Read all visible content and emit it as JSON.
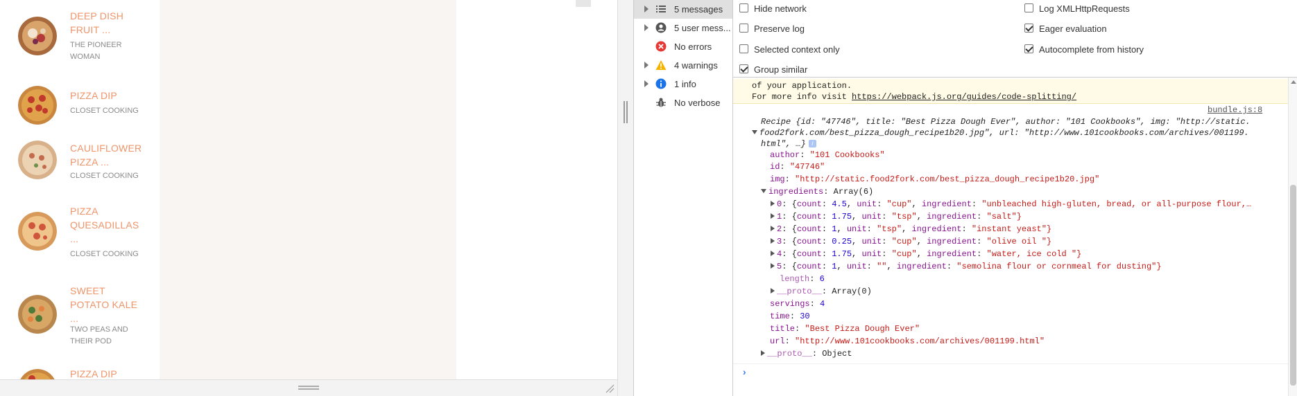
{
  "recipes": [
    {
      "title": "DEEP DISH FRUIT ...",
      "author": "THE PIONEER WOMAN"
    },
    {
      "title": "PIZZA DIP",
      "author": "CLOSET COOKING"
    },
    {
      "title": "CAULIFLOWER PIZZA ...",
      "author": "CLOSET COOKING"
    },
    {
      "title": "PIZZA QUESADILLAS ...",
      "author": "CLOSET COOKING"
    },
    {
      "title": "SWEET POTATO KALE ...",
      "author": "TWO PEAS AND THEIR POD"
    },
    {
      "title": "PIZZA DIP",
      "author": ""
    }
  ],
  "sidebar": {
    "items": [
      {
        "label": "5 messages",
        "icon": "list-icon"
      },
      {
        "label": "5 user mess...",
        "icon": "user-icon"
      },
      {
        "label": "No errors",
        "icon": "error-icon"
      },
      {
        "label": "4 warnings",
        "icon": "warning-icon"
      },
      {
        "label": "1 info",
        "icon": "info-icon"
      },
      {
        "label": "No verbose",
        "icon": "bug-icon"
      }
    ]
  },
  "settings": {
    "hide_network": "Hide network",
    "preserve_log": "Preserve log",
    "selected_context": "Selected context only",
    "group_similar": "Group similar",
    "log_xhr": "Log XMLHttpRequests",
    "eager_eval": "Eager evaluation",
    "autocomplete": "Autocomplete from history"
  },
  "console": {
    "warn_line1": "of your application.",
    "warn_line2_prefix": "For more info visit ",
    "warn_link": "https://webpack.js.org/guides/code-splitting/",
    "source": "bundle.js:8",
    "summary_line1": "Recipe {id: \"47746\", title: \"Best Pizza Dough Ever\", author: \"101 Cookbooks\", img: \"http://static.",
    "summary_line2": "food2fork.com/best_pizza_dough_recipe1b20.jpg\", url: \"http://www.101cookbooks.com/archives/001199.",
    "summary_line3": "html\", …}",
    "author_key": "author",
    "author_val": "\"101 Cookbooks\"",
    "id_key": "id",
    "id_val": "\"47746\"",
    "img_key": "img",
    "img_val": "\"http://static.food2fork.com/best_pizza_dough_recipe1b20.jpg\"",
    "ingredients_key": "ingredients",
    "ingredients_val": "Array(6)",
    "ingredients": [
      {
        "idx": "0",
        "count": "4.5",
        "unit": "\"cup\"",
        "ingredient": "\"unbleached high-gluten, bread, or all-purpose flour,…"
      },
      {
        "idx": "1",
        "count": "1.75",
        "unit": "\"tsp\"",
        "ingredient": "\"salt\"}"
      },
      {
        "idx": "2",
        "count": "1",
        "unit": "\"tsp\"",
        "ingredient": "\"instant yeast\"}"
      },
      {
        "idx": "3",
        "count": "0.25",
        "unit": "\"cup\"",
        "ingredient": "\"olive oil \"}"
      },
      {
        "idx": "4",
        "count": "1.75",
        "unit": "\"cup\"",
        "ingredient": "\"water, ice cold \"}"
      },
      {
        "idx": "5",
        "count": "1",
        "unit": "\"\"",
        "ingredient": "\"semolina flour or cornmeal for dusting\"}"
      }
    ],
    "length_key": "length",
    "length_val": "6",
    "arr_proto_key": "__proto__",
    "arr_proto_val": "Array(0)",
    "servings_key": "servings",
    "servings_val": "4",
    "time_key": "time",
    "time_val": "30",
    "title_key": "title",
    "title_val": "\"Best Pizza Dough Ever\"",
    "url_key": "url",
    "url_val": "\"http://www.101cookbooks.com/archives/001199.html\"",
    "obj_proto_key": "__proto__",
    "obj_proto_val": "Object",
    "info_badge": "i"
  },
  "colors": {
    "accent": "#f09469",
    "console_key": "#881391",
    "console_string": "#c41a16",
    "console_number": "#1c00cf"
  }
}
